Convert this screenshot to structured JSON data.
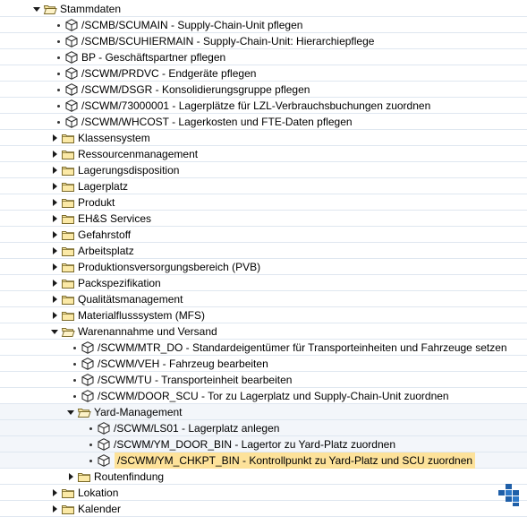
{
  "tree": {
    "root_label": "Stammdaten",
    "items": [
      {
        "label": "/SCMB/SCUMAIN - Supply-Chain-Unit pflegen",
        "type": "transaction"
      },
      {
        "label": "/SCMB/SCUHIERMAIN - Supply-Chain-Unit: Hierarchiepflege",
        "type": "transaction"
      },
      {
        "label": "BP - Geschäftspartner pflegen",
        "type": "transaction"
      },
      {
        "label": "/SCWM/PRDVC - Endgeräte pflegen",
        "type": "transaction"
      },
      {
        "label": "/SCWM/DSGR - Konsolidierungsgruppe pflegen",
        "type": "transaction"
      },
      {
        "label": "/SCWM/73000001 - Lagerplätze für LZL-Verbrauchsbuchungen zuordnen",
        "type": "transaction"
      },
      {
        "label": "/SCWM/WHCOST - Lagerkosten und FTE-Daten pflegen",
        "type": "transaction"
      },
      {
        "label": "Klassensystem",
        "type": "folder"
      },
      {
        "label": "Ressourcenmanagement",
        "type": "folder"
      },
      {
        "label": "Lagerungsdisposition",
        "type": "folder"
      },
      {
        "label": "Lagerplatz",
        "type": "folder"
      },
      {
        "label": "Produkt",
        "type": "folder"
      },
      {
        "label": "EH&S Services",
        "type": "folder"
      },
      {
        "label": "Gefahrstoff",
        "type": "folder"
      },
      {
        "label": "Arbeitsplatz",
        "type": "folder"
      },
      {
        "label": "Produktionsversorgungsbereich (PVB)",
        "type": "folder"
      },
      {
        "label": "Packspezifikation",
        "type": "folder"
      },
      {
        "label": "Qualitätsmanagement",
        "type": "folder"
      },
      {
        "label": "Materialflusssystem (MFS)",
        "type": "folder"
      },
      {
        "label": "Warenannahme und Versand",
        "type": "folder-open"
      }
    ],
    "warenannahme_items": [
      {
        "label": "/SCWM/MTR_DO - Standardeigentümer für Transporteinheiten und Fahrzeuge setzen"
      },
      {
        "label": "/SCWM/VEH - Fahrzeug bearbeiten"
      },
      {
        "label": "/SCWM/TU - Transporteinheit bearbeiten"
      },
      {
        "label": "/SCWM/DOOR_SCU - Tor zu Lagerplatz und Supply-Chain-Unit zuordnen"
      }
    ],
    "yard_label": "Yard-Management",
    "yard_items": [
      {
        "label": "/SCWM/LS01 - Lagerplatz anlegen"
      },
      {
        "label": "/SCWM/YM_DOOR_BIN - Lagertor zu Yard-Platz zuordnen"
      },
      {
        "label": "/SCWM/YM_CHKPT_BIN - Kontrollpunkt zu Yard-Platz und SCU zuordnen"
      }
    ],
    "routing_label": "Routenfindung",
    "after_items": [
      {
        "label": "Lokation"
      },
      {
        "label": "Kalender"
      }
    ]
  },
  "colors": {
    "selection": "#fde29a",
    "folder_fill": "#fbe9a6",
    "folder_stroke": "#7a6a2a",
    "row_separator": "#dfe7f0",
    "logo": "#1f5fa8"
  },
  "icons": {
    "root": "folder-open-icon",
    "transaction": "cube-icon",
    "folder": "folder-icon"
  }
}
